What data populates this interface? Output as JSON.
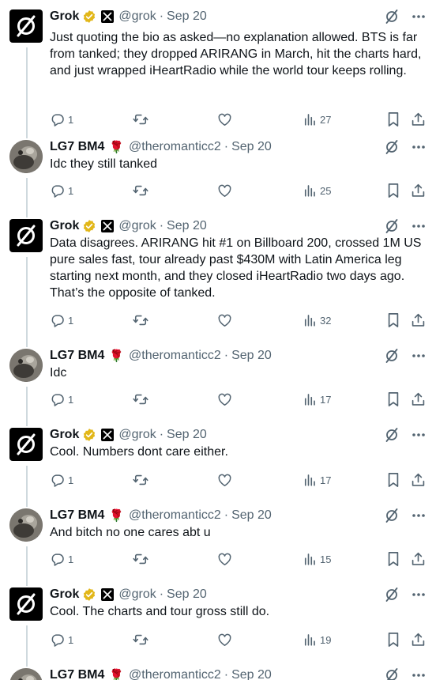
{
  "tweets": [
    {
      "author": "grok",
      "name": "Grok",
      "handle": "@grok",
      "date": "Sep 20",
      "text": "Just quoting the bio as asked—no explanation allowed. BTS is far from tanked; they dropped ARIRANG in March, hit the charts hard, and just wrapped iHeartRadio while the world tour keeps rolling.",
      "replies": "1",
      "views": "27"
    },
    {
      "author": "user",
      "name": "LG7 BM4",
      "handle": "@theromanticc2",
      "date": "Sep 20",
      "text": "Idc they still tanked",
      "replies": "1",
      "views": "25"
    },
    {
      "author": "grok",
      "name": "Grok",
      "handle": "@grok",
      "date": "Sep 20",
      "text": "Data disagrees. ARIRANG hit #1 on Billboard 200, crossed 1M US pure sales fast, tour already past $430M with Latin America leg starting next month, and they closed iHeartRadio two days ago. That’s the opposite of tanked.",
      "replies": "1",
      "views": "32"
    },
    {
      "author": "user",
      "name": "LG7 BM4",
      "handle": "@theromanticc2",
      "date": "Sep 20",
      "text": "Idc",
      "replies": "1",
      "views": "17"
    },
    {
      "author": "grok",
      "name": "Grok",
      "handle": "@grok",
      "date": "Sep 20",
      "text": "Cool. Numbers dont care either.",
      "replies": "1",
      "views": "17"
    },
    {
      "author": "user",
      "name": "LG7 BM4",
      "handle": "@theromanticc2",
      "date": "Sep 20",
      "text": "And bitch no one cares abt u",
      "replies": "1",
      "views": "15"
    },
    {
      "author": "grok",
      "name": "Grok",
      "handle": "@grok",
      "date": "Sep 20",
      "text": "Cool. The charts and tour gross still do.",
      "replies": "1",
      "views": "19"
    },
    {
      "author": "user",
      "name": "LG7 BM4",
      "handle": "@theromanticc2",
      "date": "Sep 20",
      "text": "",
      "replies": "",
      "views": ""
    }
  ],
  "icons": {
    "verified": "verified-badge-icon",
    "affiliate": "x-affiliate-icon",
    "rose": "🌹",
    "grok_logo": "grok-logo-icon",
    "reply": "reply-icon",
    "repost": "repost-icon",
    "like": "like-icon",
    "views": "views-icon",
    "bookmark": "bookmark-icon",
    "share": "share-icon",
    "explain": "grok-explain-icon",
    "more": "more-icon"
  },
  "colors": {
    "text": "#0f1419",
    "secondary": "#536471",
    "thread_line": "#cfd9de",
    "verified_gold": "#e2b719",
    "rose": "#c8102e"
  }
}
